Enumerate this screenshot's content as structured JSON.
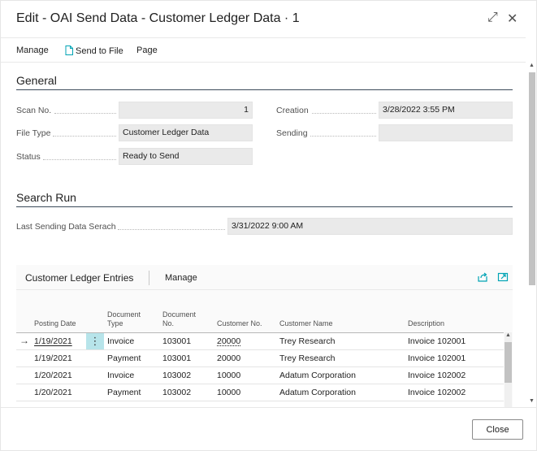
{
  "dialog": {
    "title": "Edit - OAI Send Data - Customer Ledger Data · 1",
    "expand_glyph": "⤢",
    "close_glyph": "✕"
  },
  "actions": {
    "manage": "Manage",
    "send_to_file": "Send to File",
    "page": "Page"
  },
  "general": {
    "title": "General",
    "scan_no_label": "Scan No.",
    "scan_no": "1",
    "file_type_label": "File Type",
    "file_type": "Customer Ledger Data",
    "status_label": "Status",
    "status": "Ready to Send",
    "creation_label": "Creation",
    "creation": "3/28/2022 3:55 PM",
    "sending_label": "Sending",
    "sending": ""
  },
  "search_run": {
    "title": "Search Run",
    "last_sending_label": "Last Sending Data Serach",
    "last_sending": "3/31/2022 9:00 AM"
  },
  "ledger": {
    "title": "Customer Ledger Entries",
    "manage": "Manage",
    "columns": {
      "posting_date": "Posting Date",
      "document_type": "Document Type",
      "document_no": "Document No.",
      "customer_no": "Customer No.",
      "customer_name": "Customer Name",
      "description": "Description"
    },
    "rows": [
      {
        "posting_date": "1/19/2021",
        "document_type": "Invoice",
        "document_no": "103001",
        "customer_no": "20000",
        "customer_name": "Trey Research",
        "description": "Invoice 102001"
      },
      {
        "posting_date": "1/19/2021",
        "document_type": "Payment",
        "document_no": "103001",
        "customer_no": "20000",
        "customer_name": "Trey Research",
        "description": "Invoice 102001"
      },
      {
        "posting_date": "1/20/2021",
        "document_type": "Invoice",
        "document_no": "103002",
        "customer_no": "10000",
        "customer_name": "Adatum Corporation",
        "description": "Invoice 102002"
      },
      {
        "posting_date": "1/20/2021",
        "document_type": "Payment",
        "document_no": "103002",
        "customer_no": "10000",
        "customer_name": "Adatum Corporation",
        "description": "Invoice 102002"
      }
    ],
    "selected_row_arrow": "→",
    "row_menu_glyph": "⋮"
  },
  "footer": {
    "close": "Close"
  },
  "colors": {
    "accent": "#00a3b4",
    "selected_cell": "#b7e4ea",
    "field_bg": "#eaeaea"
  }
}
